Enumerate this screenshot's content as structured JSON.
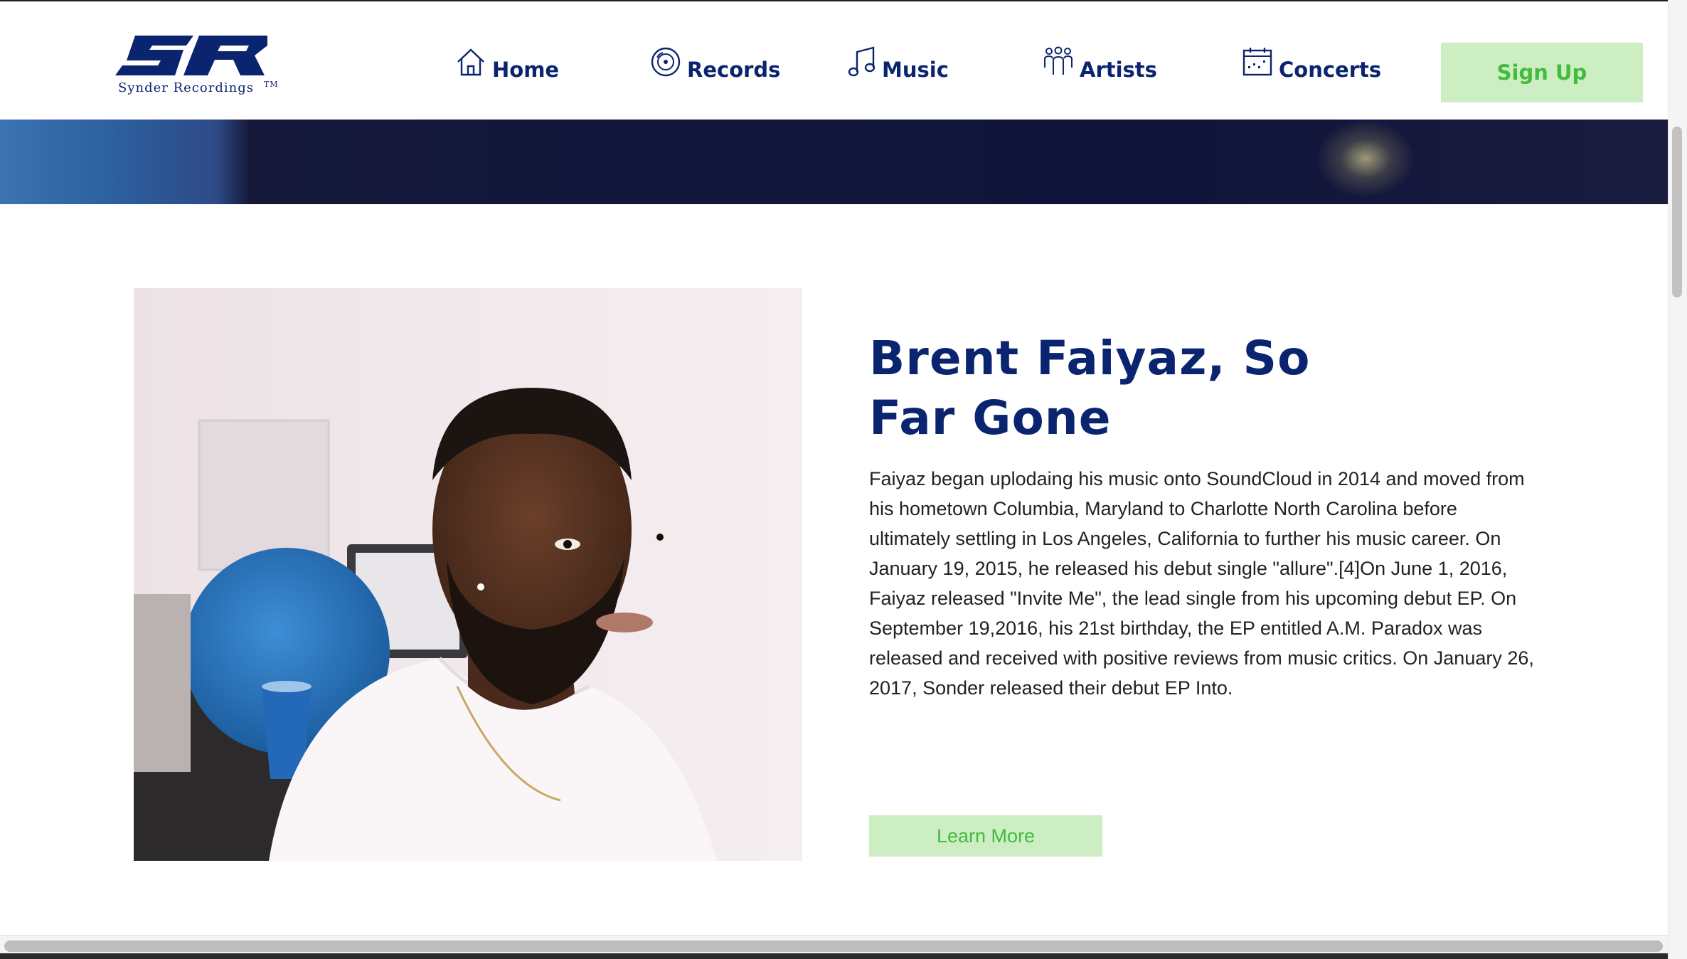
{
  "brand": {
    "name": "Synder   Recordings",
    "trademark": "TM",
    "logo_color": "#0b2470"
  },
  "nav": {
    "items": [
      {
        "label": "Home",
        "icon": "home-icon"
      },
      {
        "label": "Records",
        "icon": "record-disc-icon"
      },
      {
        "label": "Music",
        "icon": "music-note-icon"
      },
      {
        "label": "Artists",
        "icon": "people-group-icon"
      },
      {
        "label": "Concerts",
        "icon": "calendar-icon"
      }
    ],
    "signup_label": "Sign Up"
  },
  "feature": {
    "title": "Brent Faiyaz, So Far Gone",
    "bio": "Faiyaz began uplodaing his music onto SoundCloud in 2014 and moved from his hometown Columbia, Maryland to Charlotte North Carolina before ultimately settling in Los Angeles, California to further his music career. On January 19, 2015, he released his debut single \"allure\".[4]On June 1, 2016, Faiyaz released \"Invite Me\", the lead single from his upcoming debut EP. On September 19,2016, his 21st birthday, the EP entitled A.M. Paradox was released and received with positive reviews from music critics. On January 26, 2017, Sonder released their debut EP Into.",
    "cta_label": "Learn More"
  },
  "colors": {
    "primary": "#0b2470",
    "accent_bg": "#cdeec3",
    "accent_text": "#43bb3e",
    "body_text": "#222222"
  }
}
